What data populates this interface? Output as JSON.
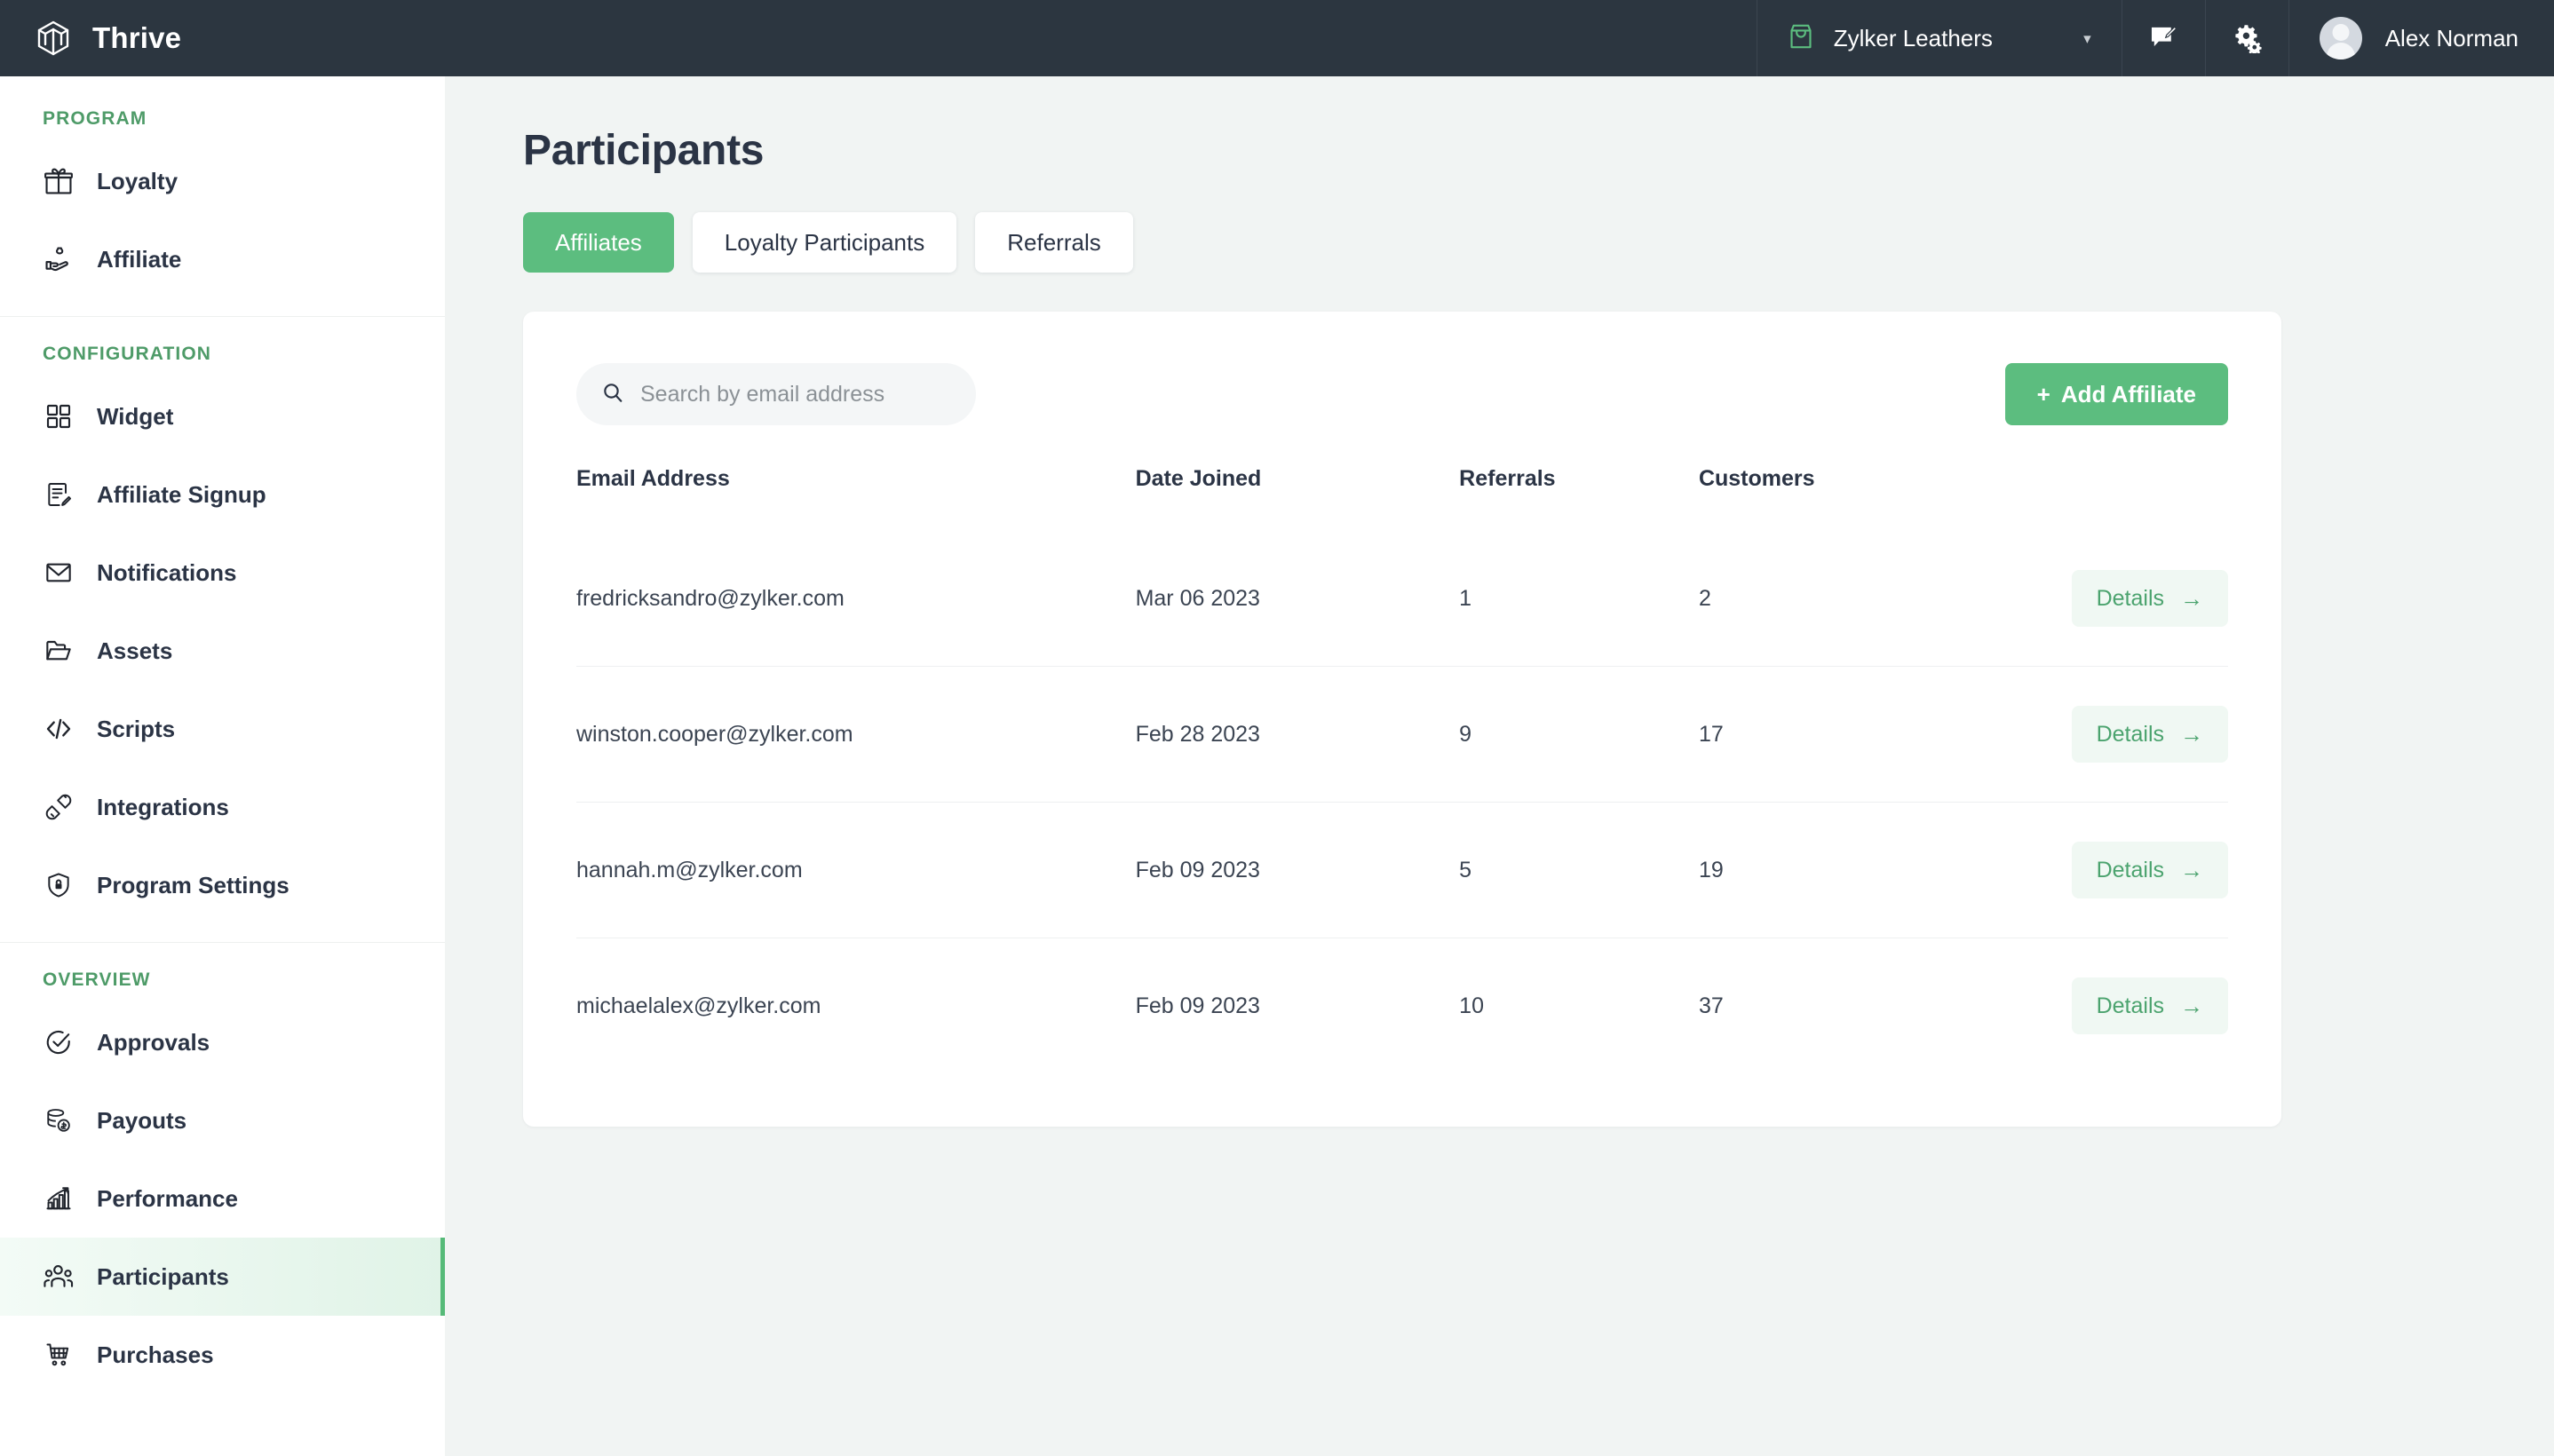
{
  "brand": {
    "name": "Thrive",
    "logo_icon": "cube-logo-icon"
  },
  "topbar": {
    "store": {
      "name": "Zylker Leathers",
      "icon": "shopping-bag-icon",
      "caret": "▾"
    },
    "feedback_icon": "feedback-chat-icon",
    "settings_icon": "gears-icon",
    "user": {
      "name": "Alex Norman",
      "avatar_icon": "avatar-icon"
    }
  },
  "sidebar": {
    "sections": [
      {
        "title": "PROGRAM",
        "items": [
          {
            "label": "Loyalty",
            "icon": "gift-icon",
            "active": false
          },
          {
            "label": "Affiliate",
            "icon": "hand-money-icon",
            "active": false
          }
        ]
      },
      {
        "title": "CONFIGURATION",
        "items": [
          {
            "label": "Widget",
            "icon": "grid-icon",
            "active": false
          },
          {
            "label": "Affiliate Signup",
            "icon": "form-edit-icon",
            "active": false
          },
          {
            "label": "Notifications",
            "icon": "envelope-icon",
            "active": false
          },
          {
            "label": "Assets",
            "icon": "folder-icon",
            "active": false
          },
          {
            "label": "Scripts",
            "icon": "code-icon",
            "active": false
          },
          {
            "label": "Integrations",
            "icon": "plug-icon",
            "active": false
          },
          {
            "label": "Program Settings",
            "icon": "shield-lock-icon",
            "active": false
          }
        ]
      },
      {
        "title": "OVERVIEW",
        "items": [
          {
            "label": "Approvals",
            "icon": "check-circle-icon",
            "active": false
          },
          {
            "label": "Payouts",
            "icon": "coins-dollar-icon",
            "active": false
          },
          {
            "label": "Performance",
            "icon": "bar-chart-arrow-icon",
            "active": false
          },
          {
            "label": "Participants",
            "icon": "people-group-icon",
            "active": true
          },
          {
            "label": "Purchases",
            "icon": "shopping-cart-icon",
            "active": false
          }
        ]
      }
    ]
  },
  "page": {
    "title": "Participants",
    "tabs": [
      {
        "label": "Affiliates",
        "active": true
      },
      {
        "label": "Loyalty Participants",
        "active": false
      },
      {
        "label": "Referrals",
        "active": false
      }
    ]
  },
  "toolbar": {
    "search": {
      "placeholder": "Search by email address",
      "value": "",
      "icon": "search-icon"
    },
    "add_button": {
      "label": "Add Affiliate",
      "plus": "+"
    }
  },
  "table": {
    "columns": [
      "Email Address",
      "Date Joined",
      "Referrals",
      "Customers"
    ],
    "action_label": "Details",
    "action_arrow": "→",
    "rows": [
      {
        "email": "fredricksandro@zylker.com",
        "date": "Mar 06 2023",
        "referrals": "1",
        "customers": "2"
      },
      {
        "email": "winston.cooper@zylker.com",
        "date": "Feb 28 2023",
        "referrals": "9",
        "customers": "17"
      },
      {
        "email": "hannah.m@zylker.com",
        "date": "Feb 09 2023",
        "referrals": "5",
        "customers": "19"
      },
      {
        "email": "michaelalex@zylker.com",
        "date": "Feb 09 2023",
        "referrals": "10",
        "customers": "37"
      }
    ]
  },
  "colors": {
    "brand_dark": "#2c3640",
    "accent_green": "#5cbd7f",
    "section_green": "#4e9b68",
    "page_bg": "#f1f4f3",
    "active_item_bg": "#e0f3e7"
  }
}
